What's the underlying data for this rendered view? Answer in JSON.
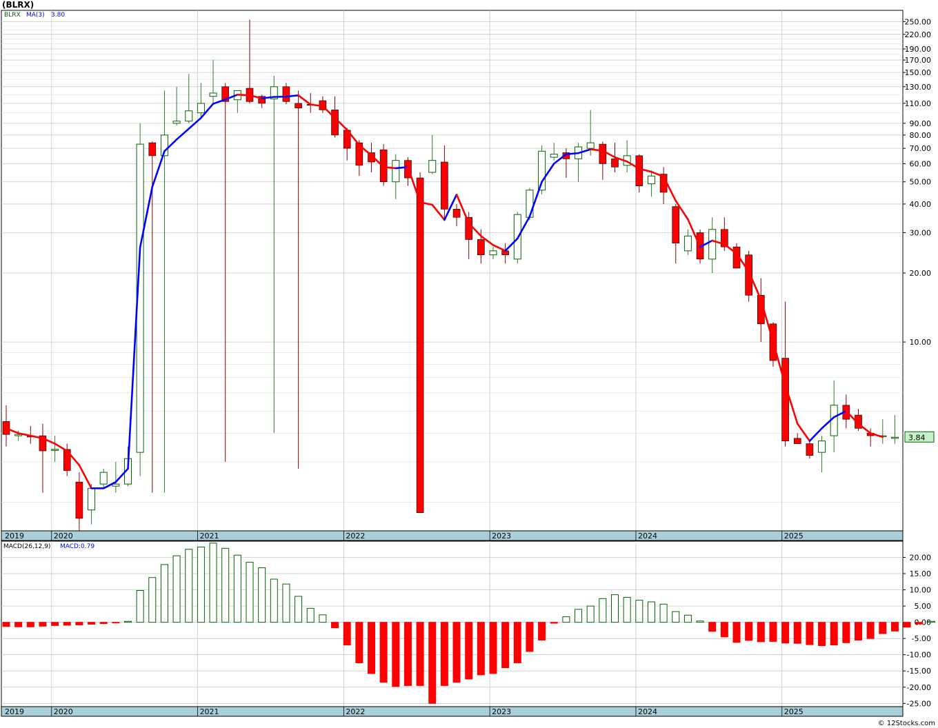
{
  "header": {
    "title": "(BLRX)"
  },
  "legend": {
    "ticker": "BLRX",
    "ma_label": "MA(3)",
    "ma_value": "3.80"
  },
  "last_price_label": "3.84",
  "footer": {
    "credit": "© 12Stocks.com"
  },
  "colors": {
    "up": "#006400",
    "down": "#ff0000",
    "ma_rising": "#0000ff",
    "ma_falling": "#ff0000",
    "macd_up": "#006400",
    "macd_down": "#ff0000",
    "band": "#a9cfd9",
    "grid": "#c8c8c8"
  },
  "chart_data": [
    {
      "type": "candlestick",
      "name": "price",
      "scale": "log",
      "period": "monthly",
      "ylim": [
        1.5,
        280
      ],
      "y_ticks": [
        "250.00",
        "220.00",
        "190.00",
        "170.00",
        "150.00",
        "130.00",
        "110.00",
        "90.00",
        "80.00",
        "70.00",
        "60.00",
        "50.00",
        "40.00",
        "30.00",
        "20.00",
        "10.00"
      ],
      "x_labels": [
        "2019",
        "2020",
        "2021",
        "2022",
        "2023",
        "2024",
        "2025"
      ],
      "x_label_index": [
        0,
        4,
        16,
        28,
        40,
        52,
        64
      ],
      "candles": [
        {
          "o": 4.5,
          "h": 5.3,
          "l": 3.5,
          "c": 3.95
        },
        {
          "o": 3.9,
          "h": 4.1,
          "l": 3.7,
          "c": 3.95
        },
        {
          "o": 3.9,
          "h": 4.3,
          "l": 3.6,
          "c": 3.85
        },
        {
          "o": 3.9,
          "h": 4.4,
          "l": 2.2,
          "c": 3.35
        },
        {
          "o": 3.4,
          "h": 3.9,
          "l": 3.0,
          "c": 3.4
        },
        {
          "o": 3.4,
          "h": 3.6,
          "l": 2.6,
          "c": 2.75
        },
        {
          "o": 2.45,
          "h": 2.7,
          "l": 1.5,
          "c": 1.7
        },
        {
          "o": 1.85,
          "h": 2.4,
          "l": 1.6,
          "c": 2.3
        },
        {
          "o": 2.4,
          "h": 2.8,
          "l": 2.3,
          "c": 2.7
        },
        {
          "o": 2.35,
          "h": 3.0,
          "l": 2.2,
          "c": 2.4
        },
        {
          "o": 2.4,
          "h": 3.5,
          "l": 2.35,
          "c": 3.1
        },
        {
          "o": 3.3,
          "h": 90,
          "l": 2.6,
          "c": 73
        },
        {
          "o": 74,
          "h": 75,
          "l": 2.2,
          "c": 65
        },
        {
          "o": 65,
          "h": 125,
          "l": 2.2,
          "c": 80
        },
        {
          "o": 90,
          "h": 130,
          "l": 88,
          "c": 92
        },
        {
          "o": 92,
          "h": 148,
          "l": 90,
          "c": 102
        },
        {
          "o": 100,
          "h": 135,
          "l": 95,
          "c": 110
        },
        {
          "o": 118,
          "h": 170,
          "l": 110,
          "c": 122
        },
        {
          "o": 130,
          "h": 135,
          "l": 3.0,
          "c": 112
        },
        {
          "o": 114,
          "h": 125,
          "l": 100,
          "c": 125
        },
        {
          "o": 128,
          "h": 255,
          "l": 110,
          "c": 112
        },
        {
          "o": 118,
          "h": 120,
          "l": 105,
          "c": 110
        },
        {
          "o": 115,
          "h": 145,
          "l": 4.0,
          "c": 130
        },
        {
          "o": 130,
          "h": 135,
          "l": 109,
          "c": 112
        },
        {
          "o": 110,
          "h": 125,
          "l": 2.8,
          "c": 105
        },
        {
          "o": 109,
          "h": 122,
          "l": 100,
          "c": 108
        },
        {
          "o": 113,
          "h": 118,
          "l": 100,
          "c": 103
        },
        {
          "o": 103,
          "h": 118,
          "l": 78,
          "c": 80
        },
        {
          "o": 84,
          "h": 86,
          "l": 62,
          "c": 70
        },
        {
          "o": 74,
          "h": 76,
          "l": 53,
          "c": 59
        },
        {
          "o": 67,
          "h": 74,
          "l": 55,
          "c": 61
        },
        {
          "o": 69,
          "h": 73,
          "l": 48,
          "c": 50
        },
        {
          "o": 50,
          "h": 66,
          "l": 42,
          "c": 62
        },
        {
          "o": 62,
          "h": 64,
          "l": 48,
          "c": 52
        },
        {
          "o": 52,
          "h": 55,
          "l": 1.8,
          "c": 1.8
        },
        {
          "o": 55,
          "h": 80,
          "l": 54,
          "c": 62
        },
        {
          "o": 61,
          "h": 72,
          "l": 34,
          "c": 38
        },
        {
          "o": 38,
          "h": 40,
          "l": 32,
          "c": 35
        },
        {
          "o": 35,
          "h": 37,
          "l": 23,
          "c": 28
        },
        {
          "o": 28,
          "h": 31,
          "l": 22,
          "c": 24
        },
        {
          "o": 24,
          "h": 26,
          "l": 23,
          "c": 25
        },
        {
          "o": 25,
          "h": 27,
          "l": 22,
          "c": 24
        },
        {
          "o": 23,
          "h": 37,
          "l": 22,
          "c": 36
        },
        {
          "o": 35,
          "h": 47,
          "l": 34,
          "c": 46
        },
        {
          "o": 46,
          "h": 72,
          "l": 44,
          "c": 68
        },
        {
          "o": 64,
          "h": 74,
          "l": 62,
          "c": 66
        },
        {
          "o": 67,
          "h": 70,
          "l": 52,
          "c": 63
        },
        {
          "o": 63,
          "h": 74,
          "l": 50,
          "c": 71
        },
        {
          "o": 70,
          "h": 103,
          "l": 65,
          "c": 74
        },
        {
          "o": 73,
          "h": 75,
          "l": 51,
          "c": 60
        },
        {
          "o": 63,
          "h": 74,
          "l": 55,
          "c": 58
        },
        {
          "o": 59,
          "h": 76,
          "l": 55,
          "c": 65
        },
        {
          "o": 65,
          "h": 66,
          "l": 45,
          "c": 48
        },
        {
          "o": 49,
          "h": 56,
          "l": 43,
          "c": 53
        },
        {
          "o": 54,
          "h": 58,
          "l": 40,
          "c": 45
        },
        {
          "o": 39,
          "h": 40,
          "l": 22,
          "c": 27
        },
        {
          "o": 25,
          "h": 31,
          "l": 24,
          "c": 29
        },
        {
          "o": 30,
          "h": 31,
          "l": 22,
          "c": 23
        },
        {
          "o": 23,
          "h": 35,
          "l": 20,
          "c": 31
        },
        {
          "o": 31,
          "h": 35,
          "l": 25,
          "c": 26
        },
        {
          "o": 26,
          "h": 27,
          "l": 21,
          "c": 21
        },
        {
          "o": 24,
          "h": 25,
          "l": 15,
          "c": 16
        },
        {
          "o": 16,
          "h": 19,
          "l": 10,
          "c": 12
        },
        {
          "o": 12,
          "h": 12.2,
          "l": 7.8,
          "c": 8.3
        },
        {
          "o": 8.5,
          "h": 15,
          "l": 3.5,
          "c": 3.7
        },
        {
          "o": 3.8,
          "h": 4.0,
          "l": 3.6,
          "c": 3.6
        },
        {
          "o": 3.6,
          "h": 3.7,
          "l": 3.1,
          "c": 3.2
        },
        {
          "o": 3.3,
          "h": 3.9,
          "l": 2.7,
          "c": 3.7
        },
        {
          "o": 3.9,
          "h": 6.8,
          "l": 3.3,
          "c": 5.3
        },
        {
          "o": 5.3,
          "h": 5.9,
          "l": 4.2,
          "c": 4.6
        },
        {
          "o": 4.8,
          "h": 5.1,
          "l": 4.1,
          "c": 4.2
        },
        {
          "o": 4.0,
          "h": 4.2,
          "l": 3.5,
          "c": 3.9
        },
        {
          "o": 3.9,
          "h": 4.6,
          "l": 3.6,
          "c": 3.9
        },
        {
          "o": 3.8,
          "h": 4.8,
          "l": 3.6,
          "c": 3.84
        }
      ],
      "ma": [
        4.2,
        4.0,
        3.9,
        3.8,
        3.6,
        3.35,
        2.9,
        2.3,
        2.3,
        2.45,
        2.8,
        25.9,
        47.5,
        68,
        76.5,
        85.2,
        95,
        109.5,
        114.3,
        120,
        119.3,
        115.7,
        117.3,
        117.7,
        119.2,
        108.7,
        107,
        95,
        84.3,
        72.3,
        65.2,
        58,
        57.3,
        58,
        40.7,
        39.7,
        34.1,
        44,
        33,
        29,
        26.5,
        25,
        28.3,
        35.3,
        50,
        60,
        66,
        66.7,
        69.3,
        68.3,
        64,
        61.3,
        57,
        55.3,
        52.7,
        41.3,
        34.3,
        26,
        27.7,
        26.7,
        24.3,
        20.3,
        15.3,
        10,
        6.5,
        4.4,
        3.7,
        4.2,
        4.7,
        5.0,
        4.4,
        4.0,
        3.85
      ],
      "last": 3.84
    },
    {
      "type": "bar",
      "name": "MACD(26,12,9)",
      "legend_label": "MACD(26,12,9)",
      "value_label": "MACD:0.79",
      "ylim": [
        -26,
        25
      ],
      "y_ticks": [
        "20.00",
        "15.00",
        "10.00",
        "5.00",
        "0.00",
        "-5.00",
        "-10.00",
        "-15.00",
        "-20.00",
        "-25.00"
      ],
      "x_labels": [
        "2019",
        "2020",
        "2021",
        "2022",
        "2023",
        "2024",
        "2025"
      ],
      "values": [
        -1.3,
        -1.4,
        -1.4,
        -1.2,
        -1.0,
        -0.9,
        -0.8,
        -0.6,
        -0.4,
        -0.2,
        0.3,
        9.8,
        13.8,
        17.8,
        20.5,
        22.5,
        23.2,
        24.4,
        22.8,
        20.7,
        18.5,
        16.8,
        13.3,
        11.8,
        8.0,
        4.3,
        2.3,
        -1.7,
        -7.0,
        -12.5,
        -15.8,
        -18.5,
        -19.8,
        -19.5,
        -19.5,
        -25.0,
        -19.5,
        -18.5,
        -17.5,
        -16.2,
        -15.8,
        -14.0,
        -12.5,
        -9.0,
        -5.5,
        -0.3,
        1.7,
        4.0,
        5.0,
        7.3,
        8.5,
        7.7,
        6.8,
        6.3,
        5.6,
        3.3,
        2.2,
        0.4,
        -2.8,
        -4.5,
        -6.2,
        -5.6,
        -6.0,
        -5.9,
        -6.4,
        -6.5,
        -6.9,
        -7.2,
        -7.0,
        -6.3,
        -5.5,
        -5.0,
        -3.5,
        -2.7,
        -1.5,
        -0.5,
        0.3,
        0.79
      ]
    }
  ]
}
